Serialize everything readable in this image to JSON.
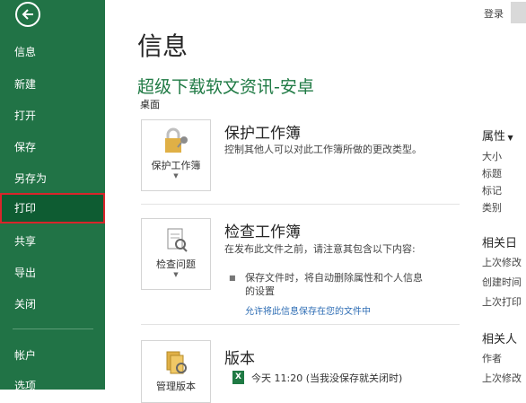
{
  "sidebar": {
    "items": [
      {
        "label": "信息"
      },
      {
        "label": "新建"
      },
      {
        "label": "打开"
      },
      {
        "label": "保存"
      },
      {
        "label": "另存为"
      },
      {
        "label": "打印"
      },
      {
        "label": "共享"
      },
      {
        "label": "导出"
      },
      {
        "label": "关闭"
      },
      {
        "label": "帐户"
      },
      {
        "label": "选项"
      }
    ],
    "selected_index": 5
  },
  "header": {
    "login_label": "登录"
  },
  "main": {
    "page_title": "信息",
    "doc_title": "超级下载软文资讯-安卓",
    "doc_path": "桌面",
    "protect": {
      "button_label": "保护工作簿",
      "title": "保护工作簿",
      "desc": "控制其他人可以对此工作簿所做的更改类型。"
    },
    "inspect": {
      "button_label": "检查问题",
      "title": "检查工作簿",
      "desc": "在发布此文件之前，请注意其包含以下内容:",
      "bullet": "保存文件时，将自动删除属性和个人信息的设置",
      "link": "允许将此信息保存在您的文件中"
    },
    "versions": {
      "button_label": "管理版本",
      "title": "版本",
      "entry": "今天 11:20 (当我没保存就关闭时)"
    }
  },
  "properties": {
    "header": "属性",
    "items": [
      "大小",
      "标题",
      "标记",
      "类别"
    ],
    "related_dates_header": "相关日",
    "dates": [
      "上次修改",
      "创建时间",
      "上次打印"
    ],
    "related_people_header": "相关人",
    "people": [
      "作者",
      "上次修改"
    ]
  },
  "colors": {
    "sidebar": "#217346",
    "selected": "#0e5c32",
    "highlight_border": "#d9252b",
    "title_green": "#1f7a44"
  }
}
